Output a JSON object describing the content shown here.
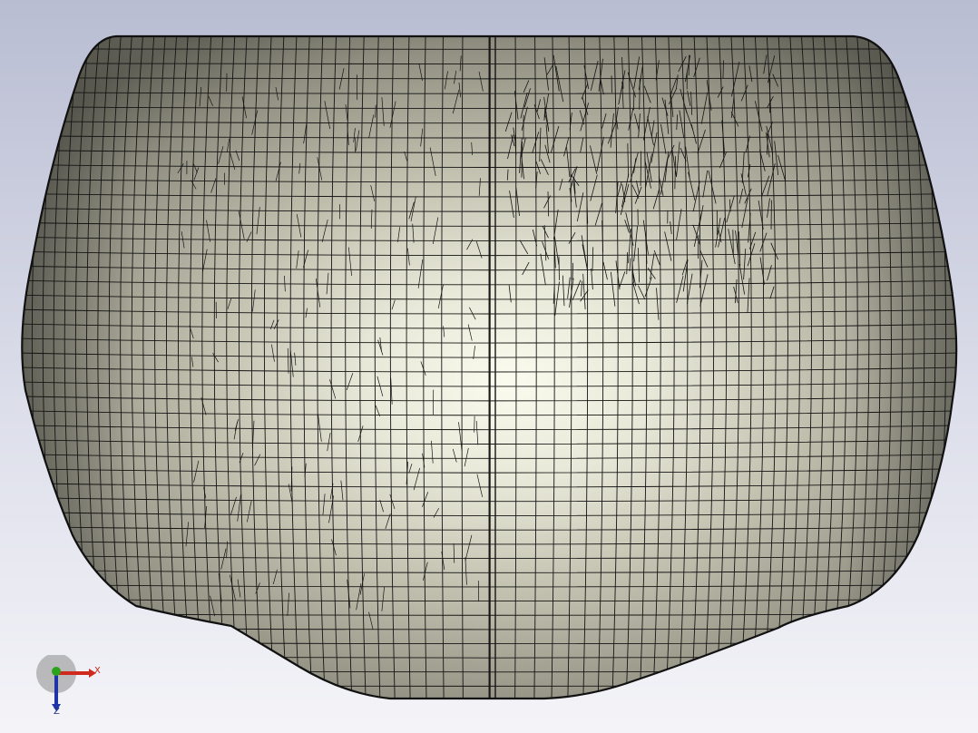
{
  "viewport": {
    "background_top": "#b9bdd2",
    "background_bottom": "#f4f4f8"
  },
  "model": {
    "surface_color": "#a9a896",
    "highlight_color": "#fbfbef",
    "shadow_color": "#5f5f55",
    "mesh_color": "#141414",
    "mesh_rows": 46,
    "mesh_cols": 72
  },
  "triad": {
    "x_label": "X",
    "z_label": "Z",
    "x_color": "#d02a1e",
    "y_color": "#2aa21a",
    "z_color": "#1f34a8"
  }
}
